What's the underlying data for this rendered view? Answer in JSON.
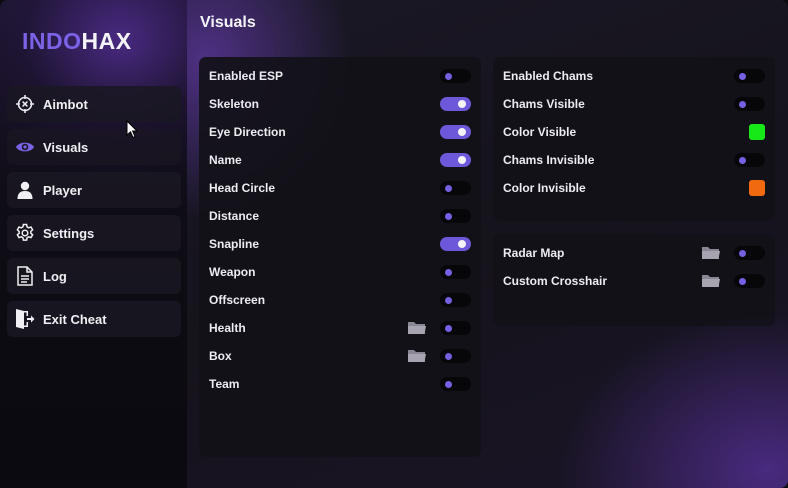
{
  "logo": {
    "part1": "INDO",
    "part2": "HAX"
  },
  "page_title": "Visuals",
  "sidebar": {
    "items": [
      {
        "label": "Aimbot",
        "icon": "crosshair-icon"
      },
      {
        "label": "Visuals",
        "icon": "eye-icon",
        "active": true
      },
      {
        "label": "Player",
        "icon": "user-icon"
      },
      {
        "label": "Settings",
        "icon": "gear-icon"
      },
      {
        "label": "Log",
        "icon": "document-icon"
      },
      {
        "label": "Exit Cheat",
        "icon": "exit-door-icon"
      }
    ]
  },
  "esp_panel": {
    "rows": [
      {
        "label": "Enabled ESP",
        "on": false
      },
      {
        "label": "Skeleton",
        "on": true
      },
      {
        "label": "Eye Direction",
        "on": true
      },
      {
        "label": "Name",
        "on": true
      },
      {
        "label": "Head Circle",
        "on": false
      },
      {
        "label": "Distance",
        "on": false
      },
      {
        "label": "Snapline",
        "on": true
      },
      {
        "label": "Weapon",
        "on": false
      },
      {
        "label": "Offscreen",
        "on": false
      },
      {
        "label": "Health",
        "on": false,
        "folder": true
      },
      {
        "label": "Box",
        "on": false,
        "folder": true
      },
      {
        "label": "Team",
        "on": false
      }
    ]
  },
  "chams_panel": {
    "rows": [
      {
        "label": "Enabled Chams",
        "type": "toggle",
        "on": false
      },
      {
        "label": "Chams Visible",
        "type": "toggle",
        "on": false
      },
      {
        "label": "Color Visible",
        "type": "color",
        "color": "#17e817"
      },
      {
        "label": "Chams Invisible",
        "type": "toggle",
        "on": false
      },
      {
        "label": "Color Invisible",
        "type": "color",
        "color": "#f26a10"
      }
    ]
  },
  "misc_panel": {
    "rows": [
      {
        "label": "Radar Map",
        "on": false,
        "folder": true
      },
      {
        "label": "Custom Crosshair",
        "on": false,
        "folder": true
      }
    ]
  },
  "colors": {
    "accent": "#6c58d8",
    "logo_accent": "#7c62e6"
  }
}
